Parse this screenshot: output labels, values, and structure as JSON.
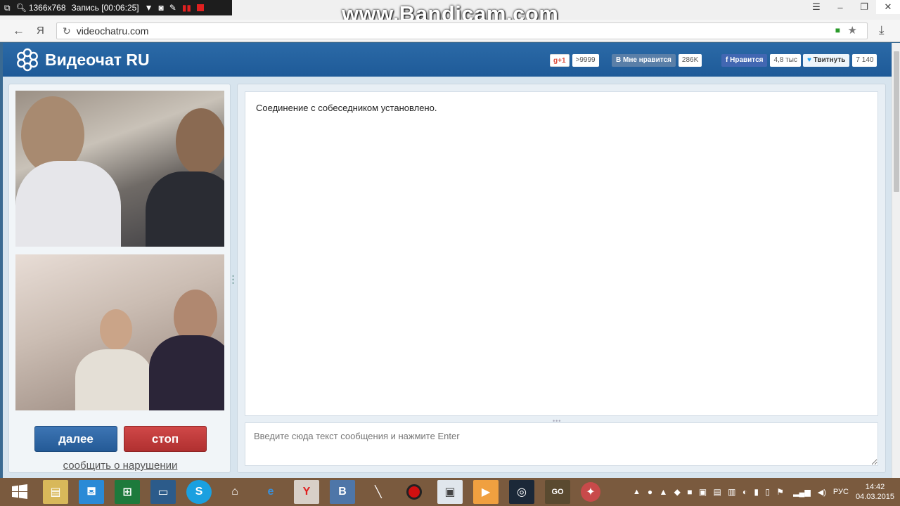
{
  "recorder": {
    "resolution": "1366x768",
    "status": "Запись [00:06:25]"
  },
  "watermark": "www.Bandicam.com",
  "browser": {
    "url": "videochatru.com",
    "yandex_label": "Я"
  },
  "site": {
    "logo_text": "Видеочат RU",
    "social": {
      "gplus_label": "g+1",
      "gplus_count": ">9999",
      "vk_icon": "B",
      "vk_label": "Мне нравится",
      "vk_count": "286K",
      "fb_label": "Нравится",
      "fb_count": "4,8 тыс",
      "tw_label": "Твитнуть",
      "tw_count": "7 140"
    }
  },
  "chat": {
    "status_message": "Соединение с собеседником установлено.",
    "input_placeholder": "Введите сюда текст сообщения и нажмите Enter"
  },
  "controls": {
    "next_label": "далее",
    "stop_label": "стоп",
    "report_label": "сообщить о нарушении"
  },
  "taskbar": {
    "language": "РУС",
    "time": "14:42",
    "date": "04.03.2015",
    "icons": [
      "start-icon",
      "file-explorer-icon",
      "store-icon",
      "excel-icon",
      "monitor-icon",
      "skype-icon",
      "home-icon",
      "internet-explorer-icon",
      "yandex-browser-icon",
      "vk-icon",
      "pen-icon",
      "record-icon",
      "photo-viewer-icon",
      "media-player-icon",
      "steam-icon",
      "csgo-icon",
      "game-icon"
    ],
    "vk_letter": "B",
    "skype_letter": "S",
    "csgo_label": "GO"
  },
  "colors": {
    "header_blue": "#2b6aa7",
    "next_blue": "#245a96",
    "stop_red": "#b03030",
    "taskbar_brown": "#7a5a3e"
  }
}
